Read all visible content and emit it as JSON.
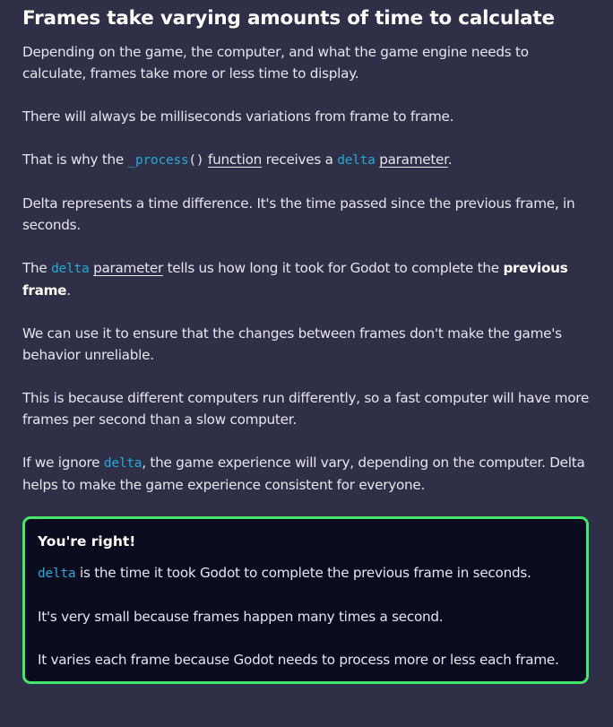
{
  "title": "Frames take varying amounts of time to calculate",
  "p1": "Depending on the game, the computer, and what the game engine needs to calculate, frames take more or less time to display.",
  "p2": "There will always be milliseconds variations from frame to frame.",
  "p3": {
    "a": "That is why the ",
    "code1": "_process",
    "code2": "()",
    "link1": "function",
    "b": " receives a ",
    "code3": "delta",
    "link2": "parameter",
    "c": "."
  },
  "p4": "Delta represents a time difference. It's the time passed since the previous frame, in seconds.",
  "p5": {
    "a": "The ",
    "code": "delta",
    "link": "parameter",
    "b": " tells us how long it took for Godot to complete the ",
    "bold": "previous frame",
    "c": "."
  },
  "p6": "We can use it to ensure that the changes between frames don't make the game's behavior unreliable.",
  "p7": "This is because different computers run differently, so a fast computer will have more frames per second than a slow computer.",
  "p8": {
    "a": "If we ignore ",
    "code": "delta",
    "b": ", the game experience will vary, depending on the computer. Delta helps to make the game experience consistent for everyone."
  },
  "feedback": {
    "title": "You're right!",
    "l1": {
      "code": "delta",
      "text": " is the time it took Godot to complete the previous frame in seconds."
    },
    "l2": "It's very small because frames happen many times a second.",
    "l3": "It varies each frame because Godot needs to process more or less each frame."
  },
  "colors": {
    "background": "#2f2f47",
    "code": "#27a9d8",
    "success_border": "#45e86c",
    "box_bg": "#0a0b1f"
  }
}
